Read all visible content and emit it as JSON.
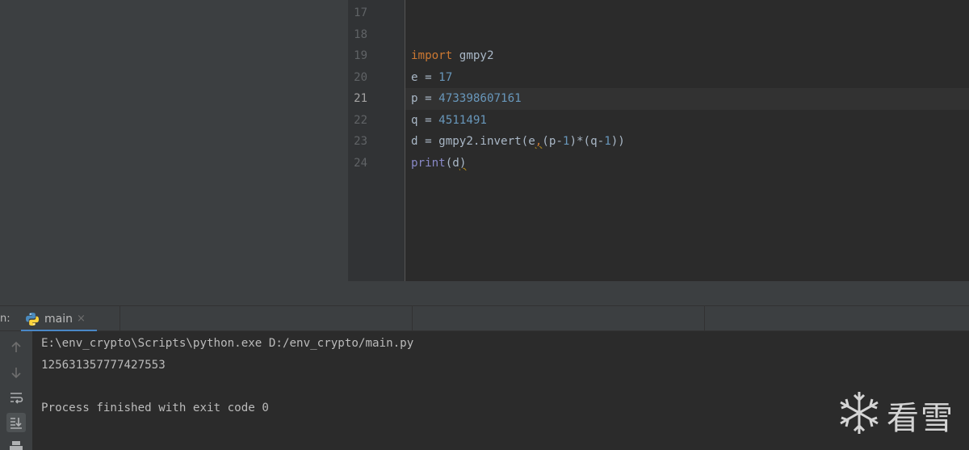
{
  "editor": {
    "line_numbers": [
      "17",
      "18",
      "19",
      "20",
      "21",
      "22",
      "23",
      "24"
    ],
    "current_line": "21",
    "code": {
      "l19_kw": "import",
      "l19_rest": " gmpy2",
      "l20_a": "e = ",
      "l20_num": "17",
      "l21_a": "p = ",
      "l21_num": "473398607161",
      "l22_a": "q = ",
      "l22_num": "4511491",
      "l23_a": "d = gmpy2.invert(e",
      "l23_comma": ",",
      "l23_b": "(p-",
      "l23_n1": "1",
      "l23_c": ")*(q-",
      "l23_n2": "1",
      "l23_d": "))",
      "l24_fn": "print",
      "l24_a": "(d",
      "l24_paren": ")"
    }
  },
  "run": {
    "label": "n:",
    "tab_label": "main",
    "close_glyph": "×"
  },
  "console": {
    "lines": [
      "E:\\env_crypto\\Scripts\\python.exe D:/env_crypto/main.py",
      "125631357777427553",
      "",
      "Process finished with exit code 0"
    ]
  },
  "toolbar_icons": [
    "arrow-up-icon",
    "arrow-down-icon",
    "soft-wrap-icon",
    "scroll-to-end-icon",
    "print-icon"
  ],
  "watermark": {
    "text": "看雪",
    "icon": "snowflake-icon"
  },
  "colors": {
    "keyword": "#cc7832",
    "number": "#6897bb",
    "builtin": "#8888c6",
    "text": "#a9b7c6",
    "tab_underline": "#4a88c7"
  }
}
